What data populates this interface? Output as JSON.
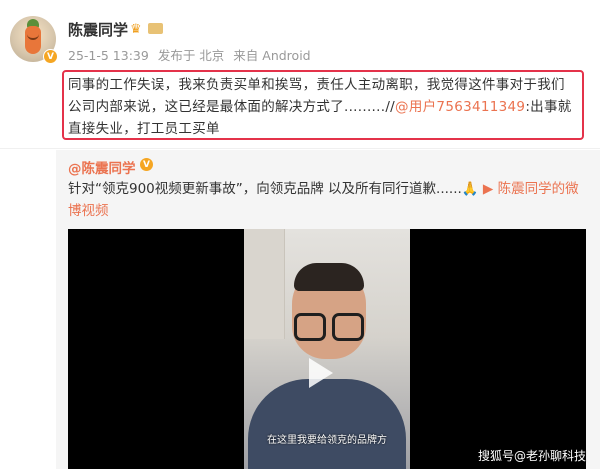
{
  "post": {
    "username": "陈震同学",
    "date": "25-1-5 13:39",
    "published_from_label": "发布于 北京",
    "device_label": "来自 Android",
    "text_part1": "同事的工作失误，我来负责买单和挨骂，责任人主动离职，我觉得这件事对于我们公司内部来说，这已经是最体面的解决方式了.........//",
    "mention": "@用户7563411349",
    "text_part2": ":出事就直接失业，打工员工买单"
  },
  "quoted": {
    "author": "@陈震同学",
    "text": "针对“领克900视频更新事故”，向领克品牌 以及所有同行道歉......🙏 ",
    "video_link": "陈震同学的微博视频"
  },
  "video": {
    "subtitle": "在这里我要给领克的品牌方"
  },
  "watermark": "搜狐号@老孙聊科技",
  "icons": {
    "verified": "verified-v-badge",
    "crown": "crown-icon",
    "play": "play-icon"
  },
  "colors": {
    "accent": "#eb7350",
    "highlight_border": "#e4324a",
    "verified": "#f5a623"
  }
}
